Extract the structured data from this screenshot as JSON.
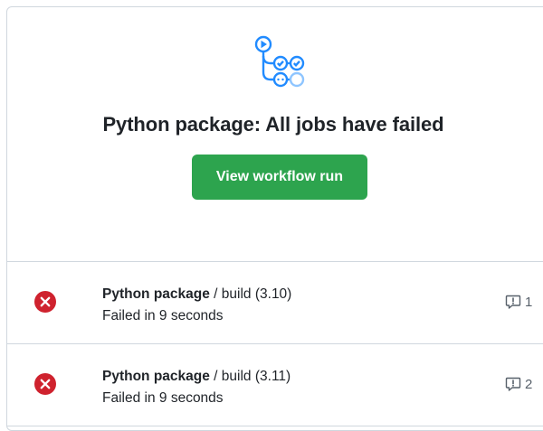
{
  "header": {
    "title": "Python package: All jobs have failed",
    "button_label": "View workflow run"
  },
  "jobs": [
    {
      "workflow": "Python package",
      "separator": " / ",
      "job_name": "build (3.10)",
      "status_text": "Failed in 9 seconds",
      "annotation_count": "1",
      "status": "failed"
    },
    {
      "workflow": "Python package",
      "separator": " / ",
      "job_name": "build (3.11)",
      "status_text": "Failed in 9 seconds",
      "annotation_count": "2",
      "status": "failed"
    }
  ],
  "colors": {
    "accent_blue": "#218bff",
    "success_green": "#2da44e",
    "failure_red": "#cf222e",
    "border": "#d0d7de"
  }
}
